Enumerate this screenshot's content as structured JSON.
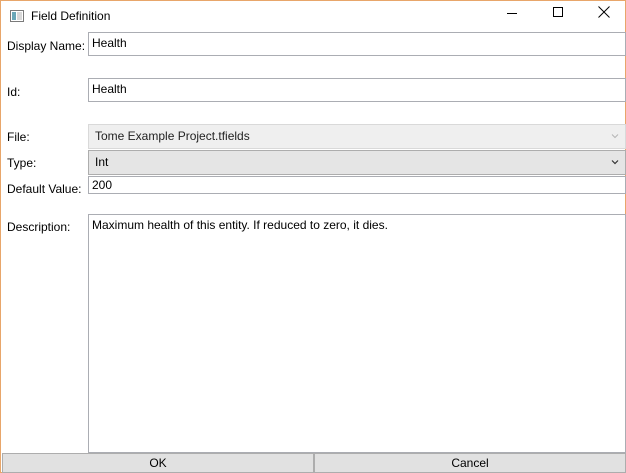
{
  "window": {
    "title": "Field Definition"
  },
  "form": {
    "display_name": {
      "label": "Display Name:",
      "value": "Health"
    },
    "id": {
      "label": "Id:",
      "value": "Health"
    },
    "file": {
      "label": "File:",
      "value": "Tome Example Project.tfields"
    },
    "type": {
      "label": "Type:",
      "value": "Int"
    },
    "default_value": {
      "label": "Default Value:",
      "value": "200"
    },
    "description": {
      "label": "Description:",
      "value": "Maximum health of this entity. If reduced to zero, it dies."
    }
  },
  "buttons": {
    "ok_label": "OK",
    "cancel_label": "Cancel"
  },
  "colors": {
    "window_border": "#e8a66a",
    "button_face": "#e1e1e1",
    "input_border": "#abadb3"
  },
  "icons": {
    "app": "app-window-icon",
    "minimize": "minimize-icon",
    "maximize": "maximize-icon",
    "close": "close-icon",
    "dropdown": "chevron-down-icon"
  }
}
